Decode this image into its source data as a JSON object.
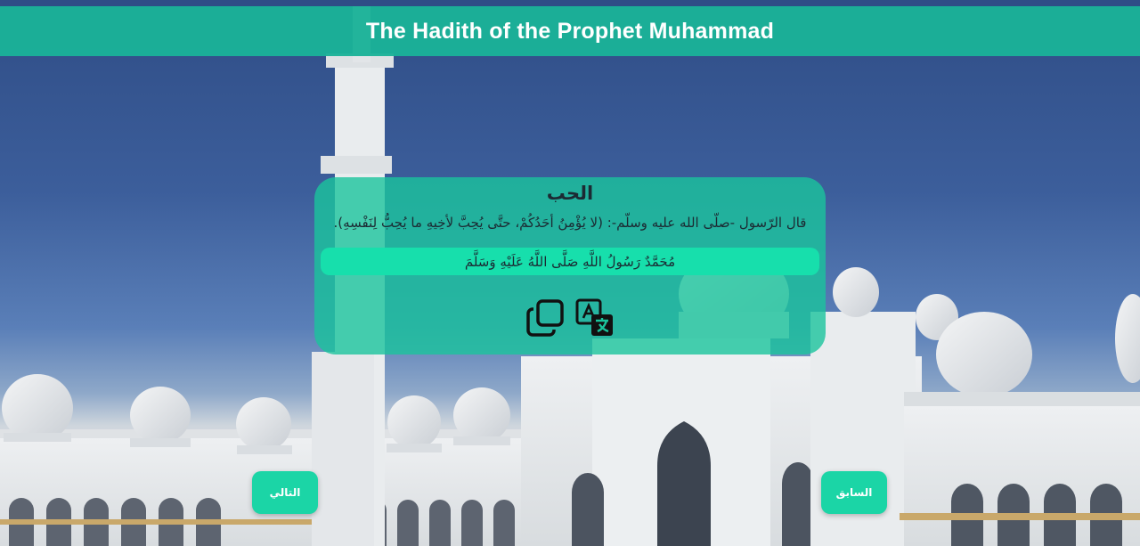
{
  "header": {
    "title": "The Hadith of the Prophet Muhammad"
  },
  "card": {
    "title": "الحب",
    "hadith_text": "قال الرّسول -صلّى الله عليه وسلّم-: (لا يُؤْمِنُ أحَدُكُمْ، حتَّى يُحِبَّ لأخِيهِ ما يُحِبُّ لِنَفْسِهِ).",
    "salawat": "مُحَمَّدٌ رَسُولُ اللَّهِ صَلَّى اللَّهُ عَلَيْهِ وَسَلَّمَ",
    "actions": [
      {
        "icon": "copy-icon"
      },
      {
        "icon": "translate-icon"
      }
    ]
  },
  "navigation": {
    "next_label": "التالي",
    "previous_label": "السابق"
  },
  "colors": {
    "accent": "#1ab298",
    "card": "#1ac49c",
    "salawat_bar": "#17dfac",
    "button": "#1bd5a6",
    "sky": "#3c5e9b"
  }
}
